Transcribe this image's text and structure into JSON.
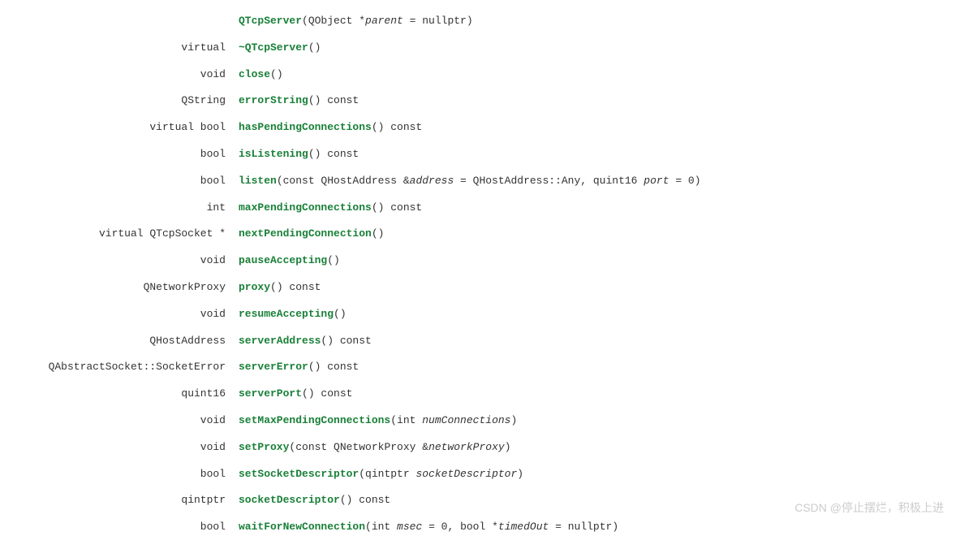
{
  "rows": [
    {
      "ret": "",
      "nm": "QTcpServer",
      "sig": "(QObject *<i>parent</i> = nullptr)"
    },
    {
      "ret": "virtual",
      "nm": "~QTcpServer",
      "sig": "()"
    },
    {
      "ret": "void",
      "nm": "close",
      "sig": "()"
    },
    {
      "ret": "QString",
      "nm": "errorString",
      "sig": "() const"
    },
    {
      "ret": "virtual bool",
      "nm": "hasPendingConnections",
      "sig": "() const"
    },
    {
      "ret": "bool",
      "nm": "isListening",
      "sig": "() const"
    },
    {
      "ret": "bool",
      "nm": "listen",
      "sig": "(const QHostAddress &<i>address</i> = QHostAddress::Any, quint16 <i>port</i> = 0)"
    },
    {
      "ret": "int",
      "nm": "maxPendingConnections",
      "sig": "() const"
    },
    {
      "ret": "virtual QTcpSocket *",
      "nm": "nextPendingConnection",
      "sig": "()"
    },
    {
      "ret": "void",
      "nm": "pauseAccepting",
      "sig": "()"
    },
    {
      "ret": "QNetworkProxy",
      "nm": "proxy",
      "sig": "() const"
    },
    {
      "ret": "void",
      "nm": "resumeAccepting",
      "sig": "()"
    },
    {
      "ret": "QHostAddress",
      "nm": "serverAddress",
      "sig": "() const"
    },
    {
      "ret": "QAbstractSocket::SocketError",
      "nm": "serverError",
      "sig": "() const"
    },
    {
      "ret": "quint16",
      "nm": "serverPort",
      "sig": "() const"
    },
    {
      "ret": "void",
      "nm": "setMaxPendingConnections",
      "sig": "(int <i>numConnections</i>)"
    },
    {
      "ret": "void",
      "nm": "setProxy",
      "sig": "(const QNetworkProxy &<i>networkProxy</i>)"
    },
    {
      "ret": "bool",
      "nm": "setSocketDescriptor",
      "sig": "(qintptr <i>socketDescriptor</i>)"
    },
    {
      "ret": "qintptr",
      "nm": "socketDescriptor",
      "sig": "() const"
    },
    {
      "ret": "bool",
      "nm": "waitForNewConnection",
      "sig": "(int <i>msec</i> = 0, bool *<i>timedOut</i> = nullptr)"
    }
  ],
  "watermark": "CSDN @停止摆烂，积极上进"
}
